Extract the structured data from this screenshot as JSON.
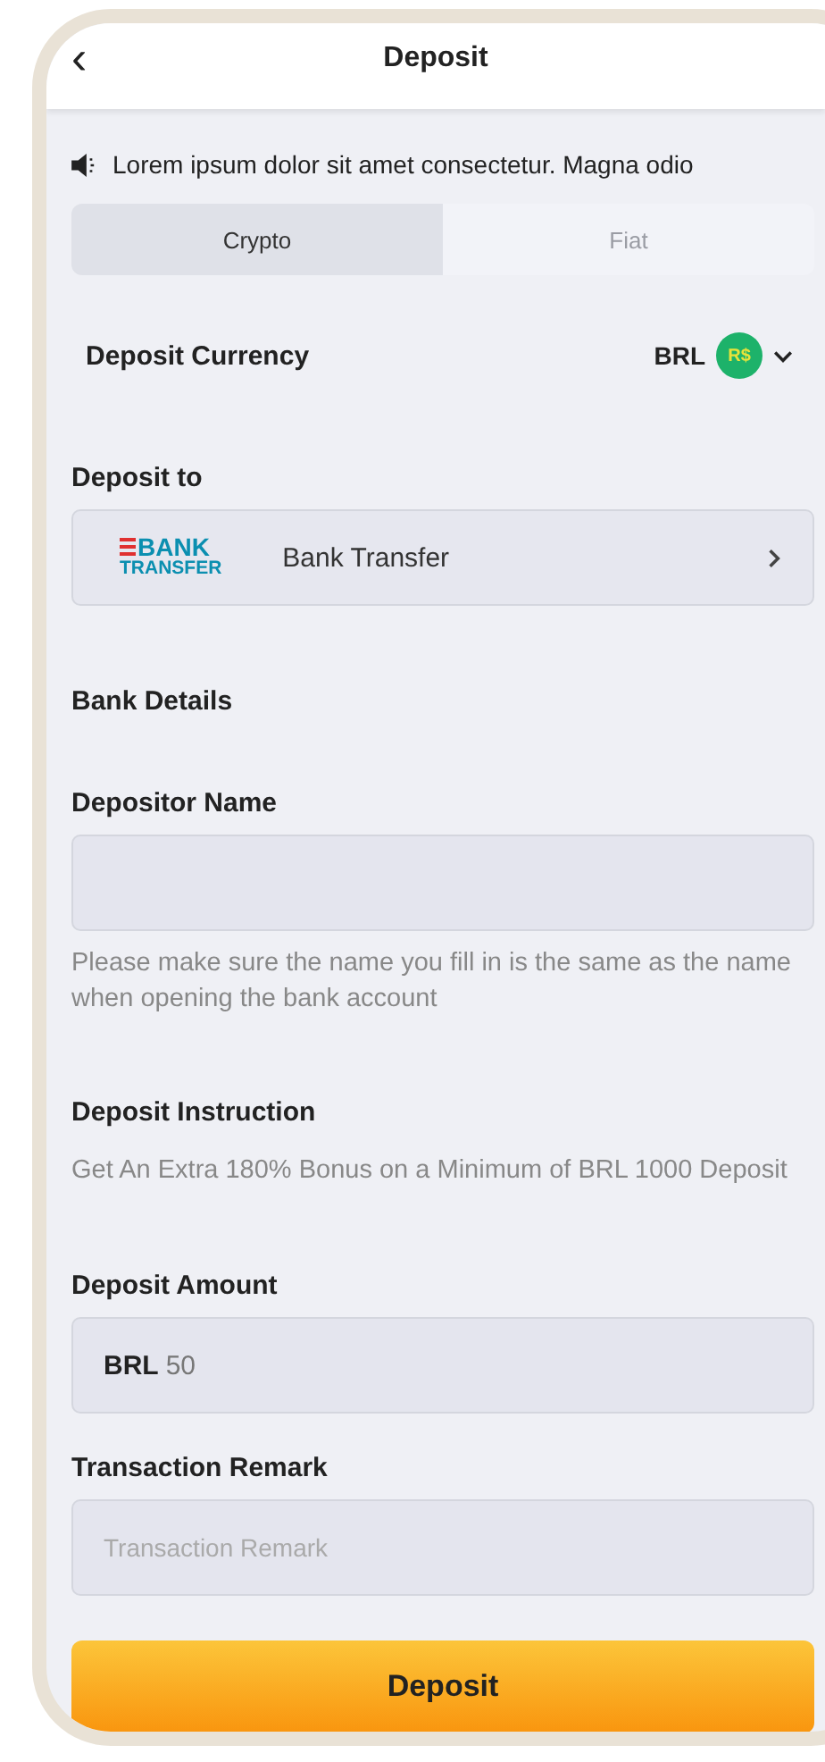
{
  "header": {
    "back": "‹",
    "title": "Deposit"
  },
  "notice": {
    "text": "Lorem ipsum dolor sit amet consectetur. Magna odio"
  },
  "tabs": [
    {
      "label": "Crypto",
      "selected": true
    },
    {
      "label": "Fiat",
      "selected": false
    }
  ],
  "currency": {
    "label": "Deposit Currency",
    "code": "BRL",
    "symbol": "R$",
    "expanded": false
  },
  "deposit_to": {
    "label": "Deposit to",
    "logo_top": "BANK",
    "logo_bottom": "TRANSFER",
    "method": "Bank Transfer"
  },
  "bank_details": {
    "title": "Bank Details",
    "name_label": "Depositor Name",
    "hint": "Please make sure the name you fill in is the same as the name when opening the bank account"
  },
  "instruction": {
    "title": "Deposit Instruction",
    "text": "Get An Extra 180% Bonus on a Minimum of BRL 1000 Deposit"
  },
  "amount": {
    "label": "Deposit Amount",
    "prefix": "BRL",
    "value": "50"
  },
  "remark": {
    "label": "Transaction Remark",
    "placeholder": "Transaction Remark"
  },
  "submit": {
    "label": "Deposit"
  }
}
